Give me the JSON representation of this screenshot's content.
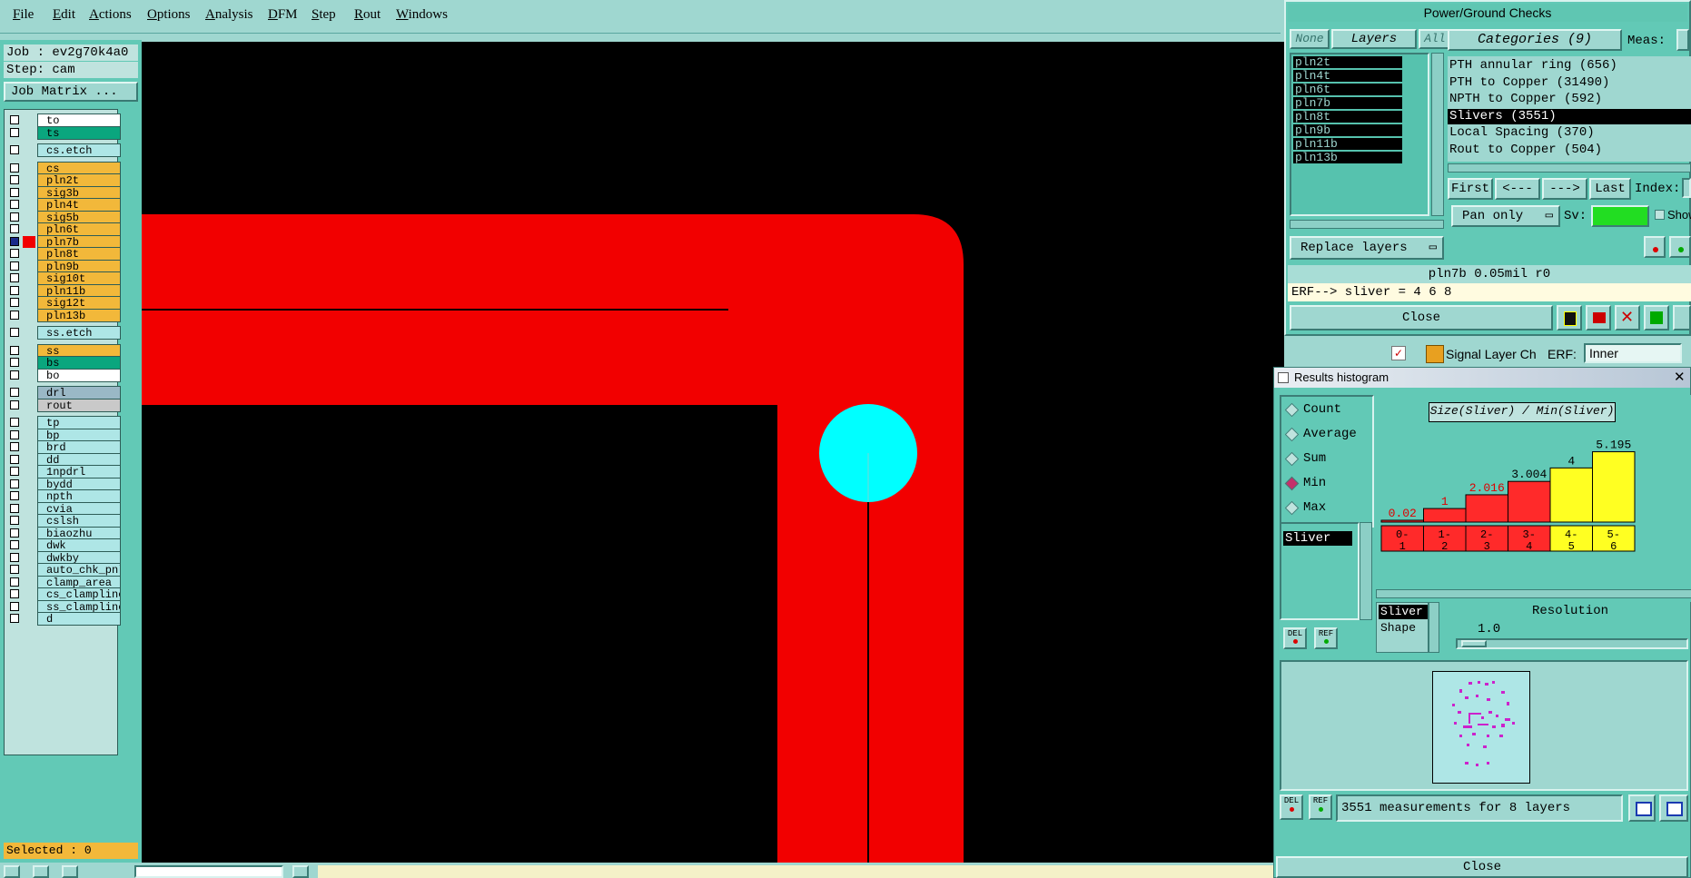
{
  "menu": [
    "File",
    "Edit",
    "Actions",
    "Options",
    "Analysis",
    "DFM",
    "Step",
    "Rout",
    "Windows"
  ],
  "job": {
    "job_line": "Job : ev2g70k4a0",
    "step_line": "Step: cam",
    "matrix_button": "Job Matrix ..."
  },
  "layers": [
    {
      "name": "to",
      "color": "#ffffff",
      "group": 1
    },
    {
      "name": "ts",
      "color": "#0aa67e",
      "group": 1
    },
    {
      "name": "cs.etch",
      "color": "#aee6e6",
      "group": 2
    },
    {
      "name": "cs",
      "color": "#f2b83a",
      "group": 3
    },
    {
      "name": "pln2t",
      "color": "#f2b83a",
      "group": 3
    },
    {
      "name": "sig3b",
      "color": "#f2b83a",
      "group": 3
    },
    {
      "name": "pln4t",
      "color": "#f2b83a",
      "group": 3
    },
    {
      "name": "sig5b",
      "color": "#f2b83a",
      "group": 3
    },
    {
      "name": "pln6t",
      "color": "#f2b83a",
      "group": 3
    },
    {
      "name": "pln7b",
      "color": "#f2b83a",
      "group": 3
    },
    {
      "name": "pln8t",
      "color": "#f2b83a",
      "group": 3
    },
    {
      "name": "pln9b",
      "color": "#f2b83a",
      "group": 3
    },
    {
      "name": "sig10t",
      "color": "#f2b83a",
      "group": 3
    },
    {
      "name": "pln11b",
      "color": "#f2b83a",
      "group": 3
    },
    {
      "name": "sig12t",
      "color": "#f2b83a",
      "group": 3
    },
    {
      "name": "pln13b",
      "color": "#f2b83a",
      "group": 3
    },
    {
      "name": "ss.etch",
      "color": "#aee6e6",
      "group": 4
    },
    {
      "name": "ss",
      "color": "#f2b83a",
      "group": 5
    },
    {
      "name": "bs",
      "color": "#0aa67e",
      "group": 5
    },
    {
      "name": "bo",
      "color": "#ffffff",
      "group": 5
    },
    {
      "name": "drl",
      "color": "#9ab8c6",
      "group": 6
    },
    {
      "name": "rout",
      "color": "#c9c9c9",
      "group": 6
    },
    {
      "name": "tp",
      "color": "#aee6e6",
      "group": 7
    },
    {
      "name": "bp",
      "color": "#aee6e6",
      "group": 7
    },
    {
      "name": "brd",
      "color": "#aee6e6",
      "group": 7
    },
    {
      "name": "dd",
      "color": "#aee6e6",
      "group": 7
    },
    {
      "name": "1npdrl",
      "color": "#aee6e6",
      "group": 7
    },
    {
      "name": "bydd",
      "color": "#aee6e6",
      "group": 7
    },
    {
      "name": "npth",
      "color": "#aee6e6",
      "group": 7
    },
    {
      "name": "cvia",
      "color": "#aee6e6",
      "group": 7
    },
    {
      "name": "cslsh",
      "color": "#aee6e6",
      "group": 7
    },
    {
      "name": "biaozhu",
      "color": "#aee6e6",
      "group": 7
    },
    {
      "name": "dwk",
      "color": "#aee6e6",
      "group": 7
    },
    {
      "name": "dwkby",
      "color": "#aee6e6",
      "group": 7
    },
    {
      "name": "auto_chk_pnl",
      "color": "#aee6e6",
      "group": 7
    },
    {
      "name": "clamp_area",
      "color": "#aee6e6",
      "group": 7
    },
    {
      "name": "cs_clampline",
      "color": "#aee6e6",
      "group": 7
    },
    {
      "name": "ss_clampline",
      "color": "#aee6e6",
      "group": 7
    },
    {
      "name": "d",
      "color": "#aee6e6",
      "group": 7
    }
  ],
  "selected": "Selected : 0",
  "pg": {
    "title": "Power/Ground Checks",
    "tab_none": "None",
    "tab_layers": "Layers",
    "tab_all": "All",
    "layer_list": [
      "pln2t",
      "pln4t",
      "pln6t",
      "pln7b",
      "pln8t",
      "pln9b",
      "pln11b",
      "pln13b"
    ],
    "categories_header": "Categories (9)",
    "meas_label": "Meas:",
    "categories": [
      "PTH annular ring (656)",
      "PTH to Copper (31490)",
      "NPTH to Copper (592)",
      "Slivers (3551)",
      "Local Spacing (370)",
      "Rout to Copper (504)"
    ],
    "selected_category": "Slivers (3551)",
    "nav_first": "First",
    "nav_prev": "<---",
    "nav_next": "--->",
    "nav_last": "Last",
    "index_label": "Index:",
    "pan_option": "Pan only",
    "sv_label": "Sv:",
    "show_label": "Show",
    "replace_button": "Replace layers",
    "status": "pln7b 0.05mil  r0",
    "erf": "ERF--> sliver = 4 6 8",
    "close": "Close",
    "signal_label": "Signal Layer Ch",
    "erf_label": "ERF:",
    "erf_value": "Inner"
  },
  "hist": {
    "title": "Results histogram",
    "options": [
      "Count",
      "Average",
      "Sum",
      "Min",
      "Max"
    ],
    "selected_option": "Min",
    "list_item": "Sliver",
    "chart_title": "Size(Sliver) / Min(Sliver)",
    "del_label": "DEL",
    "ref_label": "REF",
    "legend_sliver": "Sliver",
    "legend_shape": "Shape",
    "resolution_label": "Resolution",
    "resolution_value": "1.0",
    "summary": "3551 measurements for 8 layers",
    "close": "Close"
  },
  "chart_data": {
    "type": "bar",
    "title": "Size(Sliver) / Min(Sliver)",
    "categories": [
      "0-1",
      "1-2",
      "2-3",
      "3-4",
      "4-5",
      "5-6"
    ],
    "values": [
      0.02,
      1,
      2.016,
      3.004,
      4,
      5.195
    ],
    "labels": [
      "0.02",
      "1",
      "2.016",
      "3.004",
      "4",
      "5.195"
    ],
    "cat_top": [
      "0-",
      "1-",
      "2-",
      "3-",
      "4-",
      "5-"
    ],
    "cat_bot": [
      "1",
      "2",
      "3",
      "4",
      "5",
      "6"
    ],
    "colors": [
      "#ff2a2a",
      "#ff2a2a",
      "#ff2a2a",
      "#ff2a2a",
      "#ffff22",
      "#ffff22"
    ],
    "ylim": [
      0,
      5.5
    ]
  }
}
